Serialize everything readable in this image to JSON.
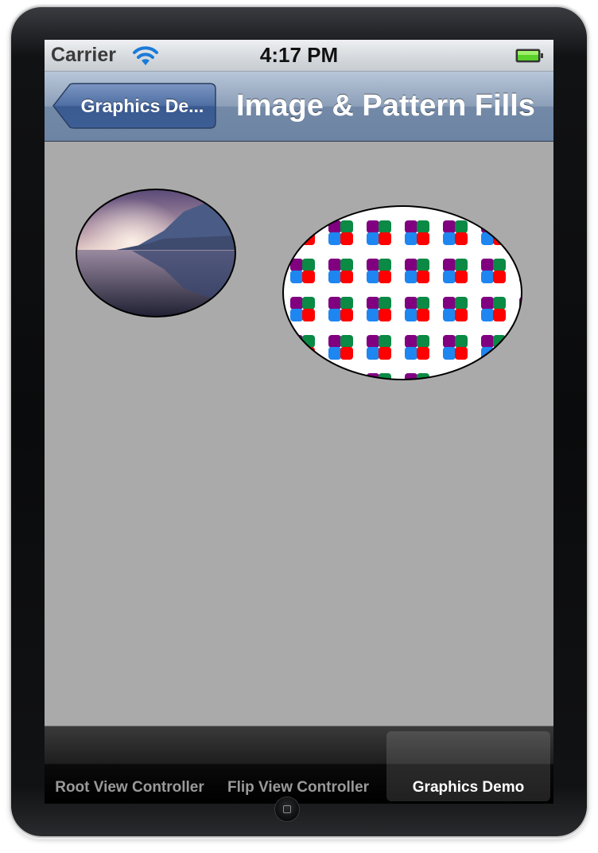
{
  "status_bar": {
    "carrier": "Carrier",
    "time": "4:17 PM",
    "icons": [
      "wifi-icon",
      "battery-icon"
    ]
  },
  "nav_bar": {
    "back_label": "Graphics De...",
    "title": "Image & Pattern Fills"
  },
  "content": {
    "background_color": "#aaaaaa",
    "shapes": [
      {
        "kind": "ellipse",
        "fill": "image",
        "description_icon": "landscape-image"
      },
      {
        "kind": "ellipse",
        "fill": "pattern",
        "pattern_colors": [
          "#800080",
          "#0a8a44",
          "#1e86f0",
          "#ff0000"
        ]
      }
    ]
  },
  "tab_bar": {
    "items": [
      {
        "label": "Root View Controller",
        "selected": false
      },
      {
        "label": "Flip View Controller",
        "selected": false
      },
      {
        "label": "Graphics Demo",
        "selected": true
      }
    ]
  },
  "colors": {
    "nav_bar": "#6d84a3",
    "tab_selected_text": "#ffffff",
    "tab_text": "#9a9a9a"
  }
}
